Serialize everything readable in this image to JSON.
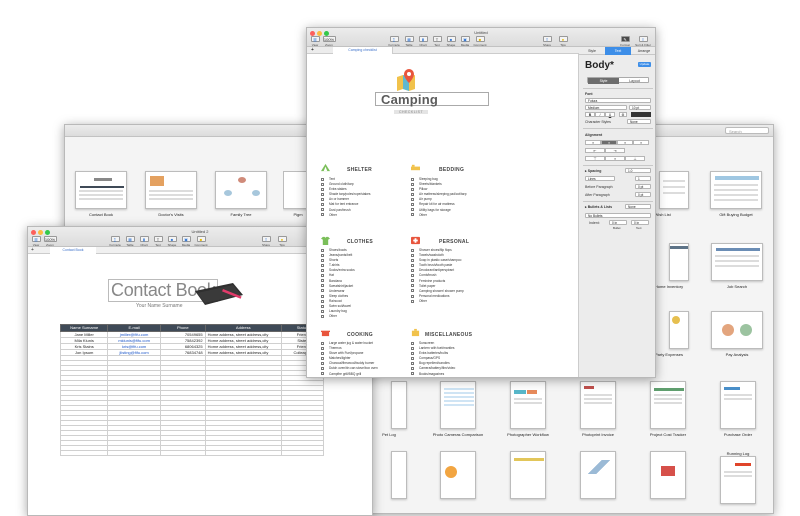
{
  "chooser": {
    "search_placeholder": "Search",
    "templates": [
      {
        "label": "Contact Book"
      },
      {
        "label": "Doctor's Visits"
      },
      {
        "label": "Family Tree"
      },
      {
        "label": "Pigm"
      },
      {
        "label": "Gift Wish List"
      },
      {
        "label": "Gift Buying Budget"
      },
      {
        "label": "Home Inventory"
      },
      {
        "label": "Job Search"
      },
      {
        "label": "Party Expenses"
      },
      {
        "label": "Pay Analysis"
      },
      {
        "label": "Pet Log"
      },
      {
        "label": "Photo Cameras Comparison"
      },
      {
        "label": "Photographer Workflow"
      },
      {
        "label": "Photoprint Invoice"
      },
      {
        "label": "Project Cost Tracker"
      },
      {
        "label": "Purchase Order"
      },
      {
        "label": "Running Log"
      }
    ]
  },
  "contact_window": {
    "title": "Untitled 2",
    "zoom": "100%",
    "toolbar": [
      "View",
      "Zoom",
      "Formula",
      "Table",
      "Chart",
      "Text",
      "Shape",
      "Media",
      "Comment",
      "Share",
      "Tips"
    ],
    "tab": "Contact Book",
    "doc_title": "Contact Book",
    "doc_subtitle": "Your Name Surname",
    "columns": [
      "Name Surname",
      "E-mail",
      "Phone",
      "Address",
      "Status"
    ],
    "rows": [
      [
        "Jane Miller",
        "jmiller@fifu.com",
        "70549655",
        "Home address, street address,city",
        "Friend"
      ],
      [
        "Mila Klunis",
        "mklunis@fifu.com",
        "75842392",
        "Home address, street address,city",
        "Sister"
      ],
      [
        "Kris Stains",
        "kris@fifu.com",
        "68064325",
        "Home address, street address,city",
        "Friend"
      ],
      [
        "Jon Ipsum",
        "jlisting@fifu.com",
        "76834748",
        "Home address, street address,city",
        "Colleague"
      ]
    ]
  },
  "camping_window": {
    "title": "Untitled",
    "zoom": "100%",
    "toolbar": [
      "View",
      "Zoom",
      "Formula",
      "Table",
      "Chart",
      "Text",
      "Shape",
      "Media",
      "Comment",
      "Share",
      "Tips",
      "Format",
      "Sort & Filter"
    ],
    "tab": "Camping checklist",
    "doc_title": "Camping",
    "doc_subtitle": "CHECKLIST",
    "sections": {
      "shelter": {
        "heading": "SHELTER",
        "items": [
          "Tent",
          "Ground cloth/tarp",
          "Extra stakes",
          "Shade tarp/poles/rope/stakes",
          "Ax or hammer",
          "Mat for tent entrance",
          "Dust pan/brush",
          "Other"
        ]
      },
      "bedding": {
        "heading": "BEDDING",
        "items": [
          "Sleeping bag",
          "Sheets/blankets",
          "Pillow",
          "Air mattress/sleeping pad/cot/tarp",
          "Air pump",
          "Repair kit for air mattress",
          "Utility bags for storage",
          "Other"
        ]
      },
      "clothes": {
        "heading": "CLOTHES",
        "items": [
          "Shoes/boots",
          "Jeans/pants/belt",
          "Shorts",
          "T-shirts",
          "Socks/extra socks",
          "Hat",
          "Bandana",
          "Sweatshirt/jacket",
          "Underwear",
          "Sleep clothes",
          "Raincoat",
          "Swim suit/towel",
          "Laundry bag",
          "Other"
        ]
      },
      "personal": {
        "heading": "PERSONAL",
        "items": [
          "Shower shoes/flip flops",
          "Towels/washcloth",
          "Soap in plastic case/shampoo",
          "Tooth brush/tooth paste",
          "Deodorant/antiperspirant",
          "Comb/brush",
          "Feminine products",
          "Toilet paper",
          "Camping shower/ shower pump",
          "Personal medications",
          "Other"
        ]
      },
      "cooking": {
        "heading": "COOKING",
        "items": [
          "Large water jug & water bucket",
          "Thermos",
          "Stove with Fuel/propane",
          "Matches/lighter",
          "Charcoal/firewood/buddy burner",
          "Dutch oven/tin can stove/box oven",
          "Campfire grill/BBQ grill",
          "Tablecloth/thumb tacks/clips",
          "Mess kit & bowls/paper plates & bowls",
          "Cutlery/plastic cutlery",
          "Measuring cups"
        ]
      },
      "misc": {
        "heading": "MISCELLANEOUS",
        "items": [
          "Sunscreen",
          "Lantern with fuel/mantles",
          "Extra batteries/bulbs",
          "Compass/GPS",
          "Bug repellent/candles",
          "Camera/battery/film/video",
          "Books/magazines",
          "Candles",
          "Maps/directions",
          "Mini-tools",
          "Fishing gear/license/bait"
        ]
      }
    },
    "inspector": {
      "tabs": [
        "Style",
        "Text",
        "Arrange"
      ],
      "para_style": "Body*",
      "update": "Update",
      "segments": [
        "Style",
        "Layout"
      ],
      "font_label": "Font",
      "font_name": "Futura",
      "font_weight": "Medium",
      "font_size": "10 pt",
      "bold": "B",
      "italic": "I",
      "underline": "U",
      "char_styles_label": "Character Styles",
      "char_styles_value": "None",
      "alignment_label": "Alignment",
      "spacing_label": "Spacing",
      "spacing_value": "1.0",
      "spacing_unit": "Lines",
      "spacing_amt": "1",
      "before_label": "Before Paragraph",
      "before_value": "0 pt",
      "after_label": "After Paragraph",
      "after_value": "0 pt",
      "bullets_label": "Bullets & Lists",
      "bullets_value": "None",
      "no_bullets": "No Bullets",
      "indent_label": "Indent:",
      "bullet_val": "0 in",
      "text_val": "0 in",
      "bullet_lbl": "Bullet",
      "text_lbl": "Text"
    }
  }
}
